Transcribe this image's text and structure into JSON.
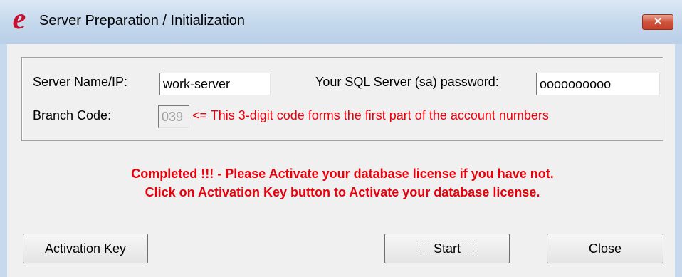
{
  "window": {
    "title": "Server Preparation / Initialization",
    "app_icon_glyph": "e",
    "close_glyph": "✕"
  },
  "form": {
    "server_label": "Server Name/IP:",
    "server_value": "work-server",
    "password_label": "Your SQL Server (sa) password:",
    "password_value": "oooooooooo",
    "branch_label": "Branch Code:",
    "branch_value": "039",
    "branch_hint": "<= This 3-digit code forms the first part of the account numbers"
  },
  "message": {
    "line1": "Completed !!! - Please Activate your database license if you have not.",
    "line2": "Click on Activation Key button to Activate your database license."
  },
  "buttons": {
    "activation_accel": "A",
    "activation_rest": "ctivation Key",
    "start_accel": "S",
    "start_rest": "tart",
    "close_accel": "C",
    "close_rest": "lose"
  },
  "colors": {
    "accent_red": "#e8000a",
    "title_bar": "#c6d9ed"
  }
}
